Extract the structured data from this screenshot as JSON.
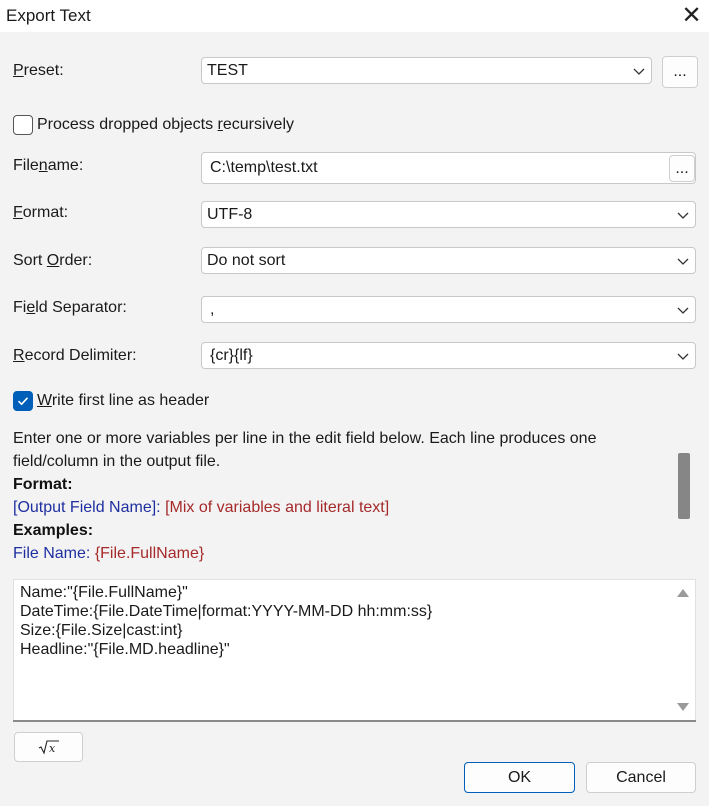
{
  "window": {
    "title": "Export Text"
  },
  "preset": {
    "label": "Preset:",
    "value": "TEST",
    "browse": "..."
  },
  "recursive": {
    "label": "Process dropped objects recursively",
    "checked": false
  },
  "filename": {
    "label": "Filename:",
    "value": "C:\\temp\\test.txt",
    "browse": "..."
  },
  "format": {
    "label": "Format:",
    "value": "UTF-8"
  },
  "sort_order": {
    "label": "Sort Order:",
    "value": "Do not sort"
  },
  "field_separator": {
    "label": "Field Separator:",
    "value": ","
  },
  "record_delimiter": {
    "label": "Record Delimiter:",
    "value": "{cr}{lf}"
  },
  "header": {
    "label": "Write first line as header",
    "checked": true
  },
  "info": {
    "line1": "Enter one or more variables per line in the edit field below. Each line produces one",
    "line2": "field/column in the output file.",
    "format_heading": "Format:",
    "format_field": "[Output Field Name]:",
    "format_mix": "[Mix of variables and literal text]",
    "examples_heading": "Examples:",
    "example_name": "File Name:",
    "example_value": "{File.FullName}"
  },
  "editor": {
    "lines": [
      "Name:\"{File.FullName}\"",
      "DateTime:{File.DateTime|format:YYYY-MM-DD hh:mm:ss}",
      "Size:{File.Size|cast:int}",
      "Headline:\"{File.MD.headline}\""
    ]
  },
  "buttons": {
    "ok": "OK",
    "cancel": "Cancel",
    "formula_icon": "square-root-x-icon"
  },
  "colors": {
    "accent": "#005fb8",
    "variable_blue": "#1f2fa0",
    "literal_red": "#a52a2a"
  }
}
